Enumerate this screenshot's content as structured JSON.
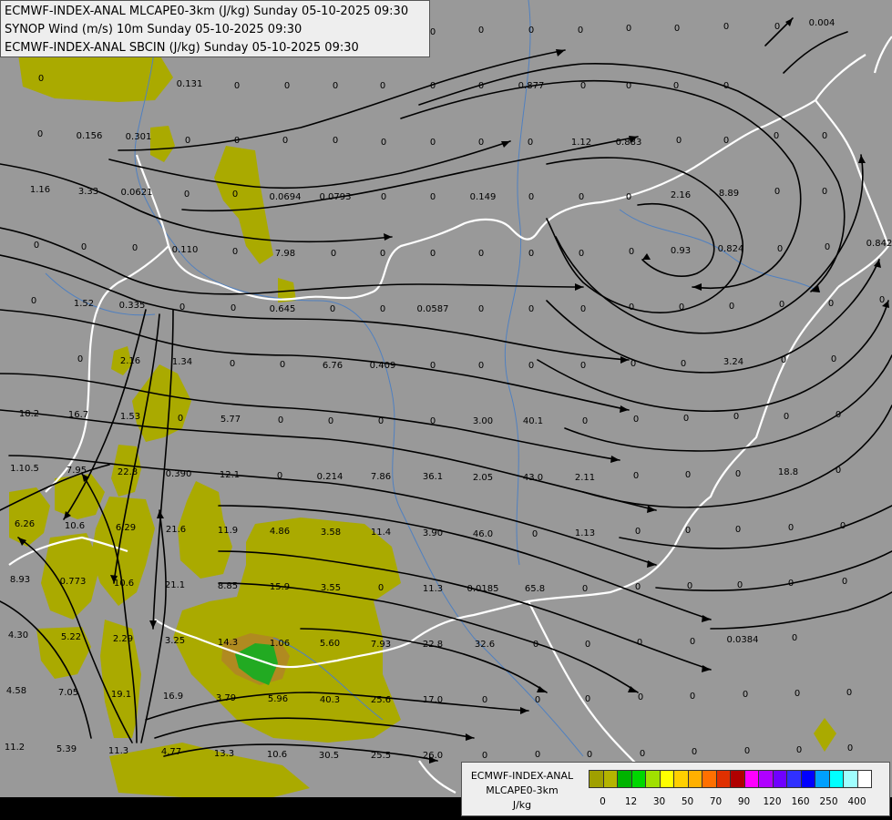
{
  "titles": [
    "ECMWF-INDEX-ANAL MLCAPE0-3km (J/kg) Sunday 05-10-2025 09:30",
    "SYNOP Wind (m/s) 10m Sunday 05-10-2025 09:30",
    "ECMWF-INDEX-ANAL SBCIN (J/kg) Sunday 05-10-2025 09:30"
  ],
  "legend": {
    "title_line1": "ECMWF-INDEX-ANAL",
    "title_line2": "MLCAPE0-3km",
    "unit": "J/kg",
    "colors": [
      "#a0a000",
      "#b4b400",
      "#00b400",
      "#00d800",
      "#a0e000",
      "#ffff00",
      "#ffd000",
      "#ffb000",
      "#ff7000",
      "#e03000",
      "#b00000",
      "#ff00ff",
      "#b000ff",
      "#7000ff",
      "#3030ff",
      "#0000ff",
      "#00a0ff",
      "#00ffff",
      "#a0ffff",
      "#ffffff"
    ],
    "ticks": [
      "0",
      "12",
      "30",
      "50",
      "70",
      "90",
      "120",
      "160",
      "250",
      "400"
    ]
  },
  "colors": {
    "background": "#999999",
    "cape_low": "#aaaa00",
    "cape_mid": "#b08a20",
    "cape_high": "#22aa22",
    "border": "#ffffff",
    "river": "#5080c0"
  },
  "values": [
    [
      "0",
      45,
      89
    ],
    [
      "0.131",
      208,
      95
    ],
    [
      "0",
      260,
      97
    ],
    [
      "0",
      315,
      97
    ],
    [
      "0",
      368,
      97
    ],
    [
      "0",
      420,
      97
    ],
    [
      "0",
      475,
      97
    ],
    [
      "0",
      528,
      97
    ],
    [
      "0.877",
      583,
      97
    ],
    [
      "0",
      640,
      97
    ],
    [
      "0",
      690,
      97
    ],
    [
      "0",
      742,
      97
    ],
    [
      "0",
      797,
      97
    ],
    [
      "0.004",
      902,
      28
    ],
    [
      "0",
      44,
      150
    ],
    [
      "0.156",
      98,
      152
    ],
    [
      "0.301",
      152,
      153
    ],
    [
      "0",
      206,
      157
    ],
    [
      "0",
      260,
      157
    ],
    [
      "0",
      313,
      157
    ],
    [
      "0",
      368,
      157
    ],
    [
      "0",
      421,
      159
    ],
    [
      "0",
      475,
      159
    ],
    [
      "0",
      528,
      159
    ],
    [
      "0",
      582,
      159
    ],
    [
      "1.12",
      638,
      159
    ],
    [
      "0.883",
      690,
      159
    ],
    [
      "0",
      745,
      157
    ],
    [
      "0",
      797,
      157
    ],
    [
      "0",
      852,
      152
    ],
    [
      "0",
      905,
      152
    ],
    [
      "1.16",
      44,
      211
    ],
    [
      "3.33",
      97,
      213
    ],
    [
      "0.0621",
      150,
      214
    ],
    [
      "0",
      205,
      216
    ],
    [
      "0",
      258,
      216
    ],
    [
      "0.0694",
      313,
      219
    ],
    [
      "0.0793",
      368,
      219
    ],
    [
      "0",
      421,
      219
    ],
    [
      "0",
      475,
      219
    ],
    [
      "0.149",
      530,
      219
    ],
    [
      "0",
      583,
      219
    ],
    [
      "0",
      638,
      219
    ],
    [
      "0",
      690,
      219
    ],
    [
      "2.16",
      747,
      217
    ],
    [
      "8.89",
      800,
      215
    ],
    [
      "0",
      853,
      213
    ],
    [
      "0",
      905,
      213
    ],
    [
      "0",
      40,
      272
    ],
    [
      "0",
      92,
      274
    ],
    [
      "0",
      148,
      275
    ],
    [
      "0.110",
      203,
      277
    ],
    [
      "0",
      258,
      279
    ],
    [
      "7.98",
      313,
      281
    ],
    [
      "0",
      366,
      281
    ],
    [
      "0",
      420,
      281
    ],
    [
      "0",
      475,
      281
    ],
    [
      "0",
      528,
      281
    ],
    [
      "0",
      583,
      281
    ],
    [
      "0",
      638,
      281
    ],
    [
      "0",
      693,
      279
    ],
    [
      "0.93",
      747,
      278
    ],
    [
      "0.824",
      802,
      276
    ],
    [
      "0",
      856,
      276
    ],
    [
      "0",
      908,
      274
    ],
    [
      "0.842",
      965,
      270
    ],
    [
      "0",
      37,
      333
    ],
    [
      "1.52",
      92,
      336
    ],
    [
      "0.335",
      145,
      338
    ],
    [
      "0",
      200,
      340
    ],
    [
      "0",
      256,
      341
    ],
    [
      "0.645",
      310,
      342
    ],
    [
      "0",
      365,
      342
    ],
    [
      "0",
      420,
      342
    ],
    [
      "0.0587",
      475,
      342
    ],
    [
      "0",
      528,
      342
    ],
    [
      "0",
      583,
      342
    ],
    [
      "0",
      640,
      342
    ],
    [
      "0",
      693,
      340
    ],
    [
      "0",
      748,
      340
    ],
    [
      "0",
      803,
      339
    ],
    [
      "0",
      858,
      337
    ],
    [
      "0",
      912,
      336
    ],
    [
      "0",
      968,
      332
    ],
    [
      "0",
      88,
      397
    ],
    [
      "2.16",
      143,
      399
    ],
    [
      "1.34",
      200,
      400
    ],
    [
      "0",
      255,
      402
    ],
    [
      "0",
      310,
      403
    ],
    [
      "6.76",
      365,
      404
    ],
    [
      "0.409",
      420,
      404
    ],
    [
      "0",
      475,
      404
    ],
    [
      "0",
      528,
      404
    ],
    [
      "0",
      583,
      404
    ],
    [
      "0",
      640,
      404
    ],
    [
      "0",
      695,
      402
    ],
    [
      "0",
      750,
      402
    ],
    [
      "3.24",
      805,
      400
    ],
    [
      "0",
      860,
      398
    ],
    [
      "0",
      915,
      397
    ],
    [
      "18.2",
      32,
      457
    ],
    [
      "16.7",
      86,
      458
    ],
    [
      "1.53",
      143,
      460
    ],
    [
      "0",
      198,
      462
    ],
    [
      "5.77",
      253,
      463
    ],
    [
      "0",
      308,
      464
    ],
    [
      "0",
      363,
      465
    ],
    [
      "0",
      418,
      465
    ],
    [
      "0",
      475,
      465
    ],
    [
      "3.00",
      530,
      465
    ],
    [
      "40.1",
      585,
      465
    ],
    [
      "0",
      642,
      465
    ],
    [
      "0",
      698,
      463
    ],
    [
      "0",
      753,
      462
    ],
    [
      "0",
      808,
      460
    ],
    [
      "0",
      863,
      460
    ],
    [
      "0",
      920,
      458
    ],
    [
      "1.10.5",
      27,
      517
    ],
    [
      "7.95",
      84,
      519
    ],
    [
      "22.8",
      140,
      521
    ],
    [
      "0.390",
      196,
      523
    ],
    [
      "12.1",
      252,
      524
    ],
    [
      "0",
      307,
      525
    ],
    [
      "0.214",
      362,
      526
    ],
    [
      "7.86",
      418,
      526
    ],
    [
      "36.1",
      475,
      526
    ],
    [
      "2.05",
      530,
      527
    ],
    [
      "43.0",
      585,
      527
    ],
    [
      "2.11",
      642,
      527
    ],
    [
      "0",
      698,
      525
    ],
    [
      "0",
      755,
      524
    ],
    [
      "0",
      810,
      523
    ],
    [
      "18.8",
      865,
      521
    ],
    [
      "0",
      920,
      519
    ],
    [
      "6.26",
      27,
      578
    ],
    [
      "10.6",
      82,
      580
    ],
    [
      "6.29",
      138,
      582
    ],
    [
      "21.6",
      193,
      584
    ],
    [
      "11.9",
      250,
      585
    ],
    [
      "4.86",
      307,
      586
    ],
    [
      "3.58",
      363,
      587
    ],
    [
      "11.4",
      418,
      587
    ],
    [
      "3.90",
      475,
      588
    ],
    [
      "46.0",
      530,
      589
    ],
    [
      "0",
      587,
      589
    ],
    [
      "1.13",
      642,
      588
    ],
    [
      "0",
      700,
      586
    ],
    [
      "0",
      755,
      585
    ],
    [
      "0",
      810,
      584
    ],
    [
      "0",
      868,
      582
    ],
    [
      "0",
      925,
      580
    ],
    [
      "8.93",
      22,
      639
    ],
    [
      "0.773",
      80,
      641
    ],
    [
      "10.6",
      136,
      643
    ],
    [
      "21.1",
      192,
      645
    ],
    [
      "8.85",
      250,
      646
    ],
    [
      "15.9",
      307,
      647
    ],
    [
      "3.55",
      363,
      648
    ],
    [
      "0",
      418,
      648
    ],
    [
      "11.3",
      475,
      649
    ],
    [
      "0.0185",
      530,
      649
    ],
    [
      "65.8",
      587,
      649
    ],
    [
      "0",
      642,
      649
    ],
    [
      "0",
      700,
      647
    ],
    [
      "0",
      757,
      646
    ],
    [
      "0",
      812,
      645
    ],
    [
      "0",
      868,
      643
    ],
    [
      "0",
      927,
      641
    ],
    [
      "4.30",
      20,
      700
    ],
    [
      "5.22",
      78,
      702
    ],
    [
      "2.29",
      135,
      704
    ],
    [
      "3.25",
      192,
      706
    ],
    [
      "14.3",
      250,
      708
    ],
    [
      "1.06",
      307,
      709
    ],
    [
      "5.60",
      362,
      709
    ],
    [
      "7.93",
      418,
      710
    ],
    [
      "22.8",
      475,
      710
    ],
    [
      "32.6",
      532,
      710
    ],
    [
      "0",
      588,
      710
    ],
    [
      "0",
      645,
      710
    ],
    [
      "0",
      702,
      708
    ],
    [
      "0",
      760,
      707
    ],
    [
      "0.0384",
      815,
      705
    ],
    [
      "0",
      872,
      703
    ],
    [
      "4.58",
      18,
      761
    ],
    [
      "7.05",
      75,
      763
    ],
    [
      "19.1",
      133,
      765
    ],
    [
      "16.9",
      190,
      767
    ],
    [
      "3.79",
      248,
      769
    ],
    [
      "5.96",
      305,
      770
    ],
    [
      "40.3",
      362,
      771
    ],
    [
      "25.6",
      418,
      771
    ],
    [
      "17.0",
      475,
      771
    ],
    [
      "0",
      532,
      771
    ],
    [
      "0",
      590,
      771
    ],
    [
      "0",
      645,
      770
    ],
    [
      "0",
      703,
      768
    ],
    [
      "0",
      760,
      767
    ],
    [
      "0",
      818,
      765
    ],
    [
      "0",
      875,
      764
    ],
    [
      "0",
      932,
      763
    ],
    [
      "11.2",
      16,
      823
    ],
    [
      "5.39",
      73,
      825
    ],
    [
      "11.3",
      130,
      827
    ],
    [
      "4.77",
      188,
      828
    ],
    [
      "13.3",
      246,
      830
    ],
    [
      "10.6",
      304,
      831
    ],
    [
      "30.5",
      361,
      832
    ],
    [
      "25.5",
      418,
      832
    ],
    [
      "26.0",
      475,
      832
    ],
    [
      "0",
      532,
      832
    ],
    [
      "0",
      590,
      831
    ],
    [
      "0",
      647,
      831
    ],
    [
      "0",
      705,
      830
    ],
    [
      "0",
      762,
      828
    ],
    [
      "0",
      820,
      827
    ],
    [
      "0",
      877,
      826
    ],
    [
      "0",
      933,
      824
    ],
    [
      "0",
      423,
      38
    ],
    [
      "0",
      475,
      38
    ],
    [
      "0",
      528,
      36
    ],
    [
      "0",
      583,
      36
    ],
    [
      "0",
      637,
      36
    ],
    [
      "0",
      690,
      34
    ],
    [
      "0",
      743,
      34
    ],
    [
      "0",
      797,
      32
    ],
    [
      "0",
      853,
      32
    ]
  ]
}
